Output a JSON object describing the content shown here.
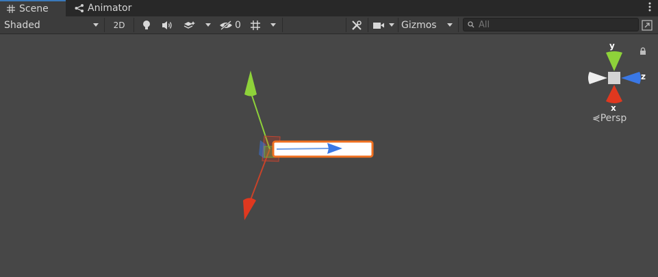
{
  "tabs": [
    {
      "label": "Scene",
      "icon": "grid-icon"
    },
    {
      "label": "Animator",
      "icon": "animator-node-icon"
    }
  ],
  "toolbar": {
    "shading_mode": "Shaded",
    "mode_2d_label": "2D",
    "hidden_count": "0",
    "gizmos_label": "Gizmos",
    "search_placeholder": "All"
  },
  "orientation_gizmo": {
    "y_label": "y",
    "z_label": "z",
    "x_label": "x",
    "projection_label": "Persp"
  },
  "colors": {
    "x_axis": "#e0381f",
    "y_axis": "#8ed23a",
    "z_axis": "#3a78e6",
    "selection_outline": "#f07020",
    "background": "#474747"
  }
}
